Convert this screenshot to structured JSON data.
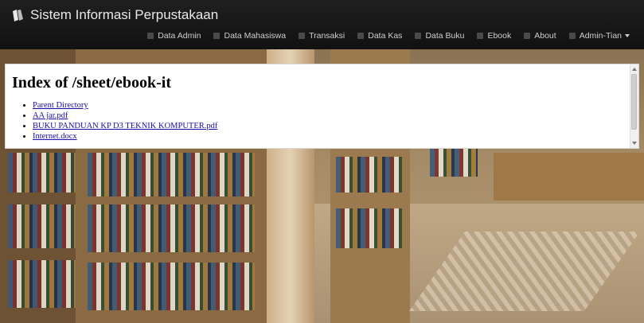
{
  "brand": {
    "title": "Sistem Informasi Perpustakaan",
    "icon": "books-icon"
  },
  "nav": {
    "items": [
      {
        "label": "Data Admin",
        "icon": "pencil-icon"
      },
      {
        "label": "Data Mahasiswa",
        "icon": "document-icon"
      },
      {
        "label": "Transaksi",
        "icon": "grid-icon"
      },
      {
        "label": "Data Kas",
        "icon": "columns-icon"
      },
      {
        "label": "Data Buku",
        "icon": "list-icon"
      },
      {
        "label": "Ebook",
        "icon": "book-icon"
      },
      {
        "label": "About",
        "icon": "home-icon"
      },
      {
        "label": "Admin-Tian",
        "icon": "user-icon"
      }
    ]
  },
  "panel": {
    "heading": "Index of /sheet/ebook-it",
    "files": [
      "Parent Directory",
      "AA jar.pdf",
      "BUKU PANDUAN KP D3 TEKNIK KOMPUTER.pdf",
      "Internet.docx"
    ]
  }
}
